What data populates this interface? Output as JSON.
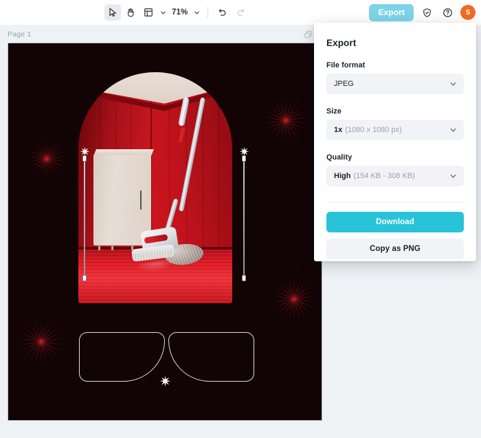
{
  "toolbar": {
    "tools": [
      {
        "name": "select-tool",
        "icon": "cursor-arrow-icon",
        "active": true
      },
      {
        "name": "hand-tool",
        "icon": "hand-icon",
        "active": false
      },
      {
        "name": "layout-tool",
        "icon": "layout-grid-icon",
        "active": false
      }
    ],
    "zoom_level": "71%",
    "undo_label": "undo-icon",
    "redo_label": "redo-icon",
    "export_label": "Export",
    "shield_icon": "shield-check-icon",
    "help_icon": "help-circle-icon",
    "avatar_initial": "S"
  },
  "canvas": {
    "page_label": "Page 1",
    "duplicate_icon": "duplicate-page-icon"
  },
  "export_panel": {
    "title": "Export",
    "file_format": {
      "label": "File format",
      "value": "JPEG"
    },
    "size": {
      "label": "Size",
      "value_strong": "1x",
      "value_muted": "(1080 x 1080 px)"
    },
    "quality": {
      "label": "Quality",
      "value_strong": "High",
      "value_muted": "(154 KB - 308 KB)"
    },
    "download_label": "Download",
    "copy_png_label": "Copy as PNG"
  },
  "colors": {
    "accent_cyan": "#29c3d9",
    "export_button": "#7ed3e8",
    "avatar_orange": "#ef6c21",
    "page_bg": "#eef2f5",
    "field_bg": "#f1f3f6",
    "canvas_bg": "#120304"
  }
}
